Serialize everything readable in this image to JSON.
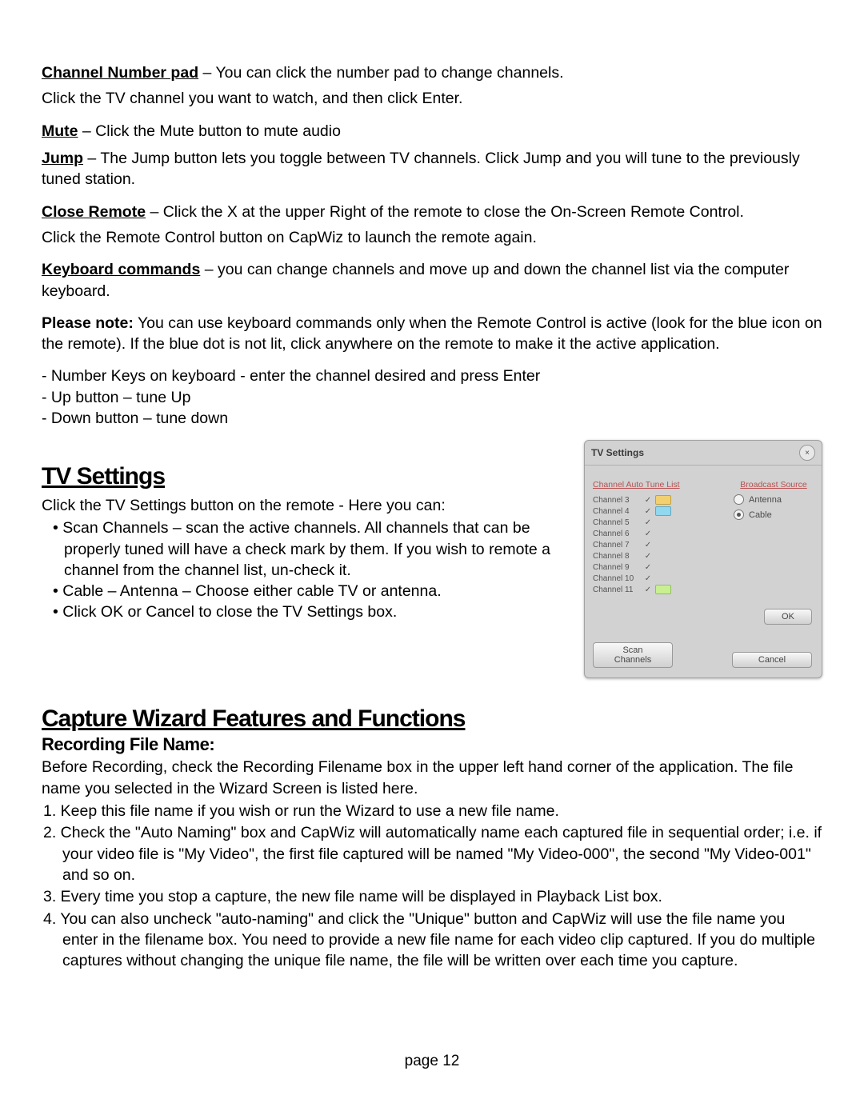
{
  "section_channel_pad": {
    "label": "Channel Number pad",
    "text1": " – You can click the number pad to change channels.",
    "text2": "Click the TV channel you want to watch, and then click Enter."
  },
  "section_mute": {
    "label": "Mute",
    "text": " –  Click the Mute button to mute audio"
  },
  "section_jump": {
    "label": "Jump",
    "text": " – The Jump button lets you toggle between TV channels. Click Jump and you will tune to the previously tuned station."
  },
  "section_close_remote": {
    "label": "Close Remote",
    "text1": " – Click the X at the upper Right of the remote to close the On-Screen Remote Control.",
    "text2": "Click the Remote Control button on CapWiz to launch the remote again."
  },
  "section_keyboard": {
    "label": "Keyboard commands",
    "text": " – you can change channels and move up and down the channel list via the computer keyboard."
  },
  "please_note": {
    "label": "Please note:",
    "text": " You can use keyboard commands only when the Remote Control is active (look for the blue icon on the remote). If the blue dot is not lit, click anywhere on the remote to make it the active application."
  },
  "key_list": {
    "k1": "- Number Keys on keyboard -  enter the channel desired and press Enter",
    "k2": "- Up button – tune Up",
    "k3": "- Down button – tune down"
  },
  "tv_heading": "TV Settings",
  "tv_intro": "Click the TV Settings button on the remote -  Here you can:",
  "tv_bullets": {
    "b1": "• Scan Channels – scan the active channels. All channels that can be properly tuned will have a check mark by them. If you wish to remote a channel from the channel list, un-check it.",
    "b2": "• Cable – Antenna – Choose either cable TV or antenna.",
    "b3": "• Click OK or Cancel to close the TV Settings box."
  },
  "tv_dialog": {
    "title": "TV Settings",
    "header_left": "Channel Auto Tune List",
    "header_right": "Broadcast Source",
    "source_antenna": "Antenna",
    "source_cable": "Cable",
    "ok_label": "OK",
    "scan_label": "Scan Channels",
    "cancel_label": "Cancel",
    "channels": [
      {
        "name": "Channel 3",
        "badge": "yellow"
      },
      {
        "name": "Channel 4",
        "badge": "cyan"
      },
      {
        "name": "Channel 5",
        "badge": ""
      },
      {
        "name": "Channel 6",
        "badge": ""
      },
      {
        "name": "Channel 7",
        "badge": ""
      },
      {
        "name": "Channel 8",
        "badge": ""
      },
      {
        "name": "Channel 9",
        "badge": ""
      },
      {
        "name": "Channel 10",
        "badge": ""
      },
      {
        "name": "Channel 11",
        "badge": "lime"
      }
    ]
  },
  "cw_heading": "Capture Wizard Features and Functions",
  "recording_heading": "Recording File Name:",
  "recording_intro": "Before Recording, check the Recording Filename box in the upper left hand corner of the application. The file name you selected in the Wizard Screen is listed here.",
  "recording_list": {
    "r1": "1. Keep this file name if you wish or run the Wizard to use a new file name.",
    "r2": "2. Check the \"Auto Naming\" box and CapWiz will automatically name each captured file in sequential order; i.e. if your video file is \"My Video\", the first file captured will be named \"My Video-000\", the second \"My Video-001\" and so on.",
    "r3": "3. Every time you stop a capture, the new file name will be displayed in Playback List box.",
    "r4": "4. You can also uncheck \"auto-naming\" and click the \"Unique\" button and CapWiz will use the file name you enter in the filename box.   You need to provide a new file name for each video clip captured. If you do multiple captures without changing the unique file name, the file will be written over each time you capture."
  },
  "page_number": "page 12"
}
